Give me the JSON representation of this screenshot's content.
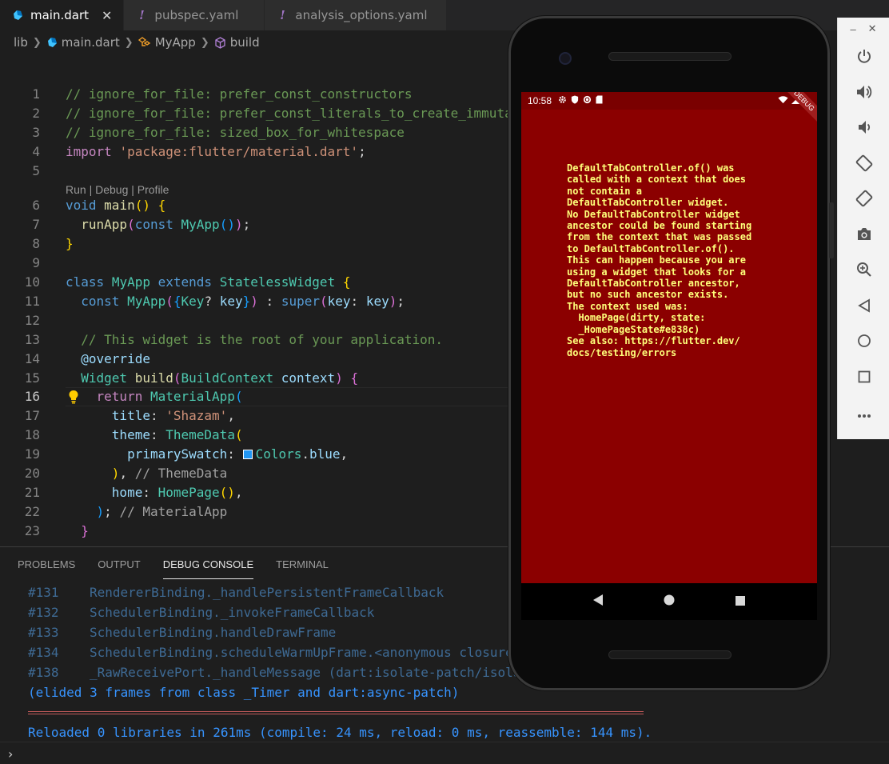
{
  "tabs": [
    {
      "label": "main.dart",
      "active": true,
      "icon": "dart-icon"
    },
    {
      "label": "pubspec.yaml",
      "active": false,
      "icon": "exclamation-icon"
    },
    {
      "label": "analysis_options.yaml",
      "active": false,
      "icon": "exclamation-icon"
    }
  ],
  "tab_close_glyph": "✕",
  "breadcrumb": {
    "folder": "lib",
    "file": "main.dart",
    "class": "MyApp",
    "method": "build"
  },
  "codelens": "Run | Debug | Profile",
  "code": {
    "l1": "// ignore_for_file: prefer_const_constructors",
    "l2": "// ignore_for_file: prefer_const_literals_to_create_immutables",
    "l3": "// ignore_for_file: sized_box_for_whitespace",
    "import_kw": "import",
    "import_str": "'package:flutter/material.dart'",
    "void": "void",
    "main": "main",
    "runApp": "runApp",
    "const": "const",
    "MyApp": "MyApp",
    "class": "class",
    "extends": "extends",
    "StatelessWidget": "StatelessWidget",
    "Key": "Key",
    "key": "key",
    "super": "super",
    "l13": "// This widget is the root of your application.",
    "override": "@override",
    "Widget": "Widget",
    "build": "build",
    "BuildContext": "BuildContext",
    "context": "context",
    "return": "return",
    "MaterialApp": "MaterialApp",
    "title": "title",
    "title_val": "'Shazam'",
    "theme": "theme",
    "ThemeData": "ThemeData",
    "primarySwatch": "primarySwatch",
    "Colors": "Colors",
    "blue": "blue",
    "hint_theme": "// ThemeData",
    "home": "home",
    "HomePage": "HomePage",
    "hint_material": "// MaterialApp"
  },
  "panel": {
    "tabs": [
      "PROBLEMS",
      "OUTPUT",
      "DEBUG CONSOLE",
      "TERMINAL"
    ],
    "active_tab": "DEBUG CONSOLE",
    "frames": [
      {
        "num": "#131",
        "text": "RendererBinding._handlePersistentFrameCallback"
      },
      {
        "num": "#132",
        "text": "SchedulerBinding._invokeFrameCallback"
      },
      {
        "num": "#133",
        "text": "SchedulerBinding.handleDrawFrame"
      },
      {
        "num": "#134",
        "text": "SchedulerBinding.scheduleWarmUpFrame.<anonymous closure>"
      },
      {
        "num": "#138",
        "text": "_RawReceivePort._handleMessage (dart:isolate-patch/isolate_patch.dart)"
      }
    ],
    "elided": "(elided 3 frames from class _Timer and dart:async-patch)",
    "reload": "Reloaded 0 libraries in 261ms (compile: 24 ms, reload: 0 ms, reassemble: 144 ms).",
    "prompt": "›"
  },
  "phone": {
    "time": "10:58",
    "debug_banner": "DEBUG",
    "error_text": "DefaultTabController.of() was\ncalled with a context that does\nnot contain a\nDefaultTabController widget.\nNo DefaultTabController widget\nancestor could be found starting\nfrom the context that was passed\nto DefaultTabController.of().\nThis can happen because you are\nusing a widget that looks for a\nDefaultTabController ancestor,\nbut no such ancestor exists.\nThe context used was:\n  HomePage(dirty, state:\n  _HomePageState#e838c)\nSee also: https://flutter.dev/\ndocs/testing/errors",
    "colors": {
      "error_bg": "#8b0000",
      "error_text": "#ffff7a",
      "status_bg": "#7a0000"
    }
  },
  "emulator": {
    "minimize": "–",
    "close": "✕",
    "buttons": [
      "power-icon",
      "volume-up-icon",
      "volume-down-icon",
      "rotate-left-icon",
      "rotate-right-icon",
      "camera-icon",
      "zoom-icon",
      "back-icon",
      "home-icon",
      "overview-icon",
      "more-icon"
    ]
  },
  "colors": {
    "editor_bg": "#1e1e1e",
    "comment": "#6a9955",
    "keyword": "#569cd6",
    "type": "#4ec9b0",
    "link": "#3794ff"
  }
}
